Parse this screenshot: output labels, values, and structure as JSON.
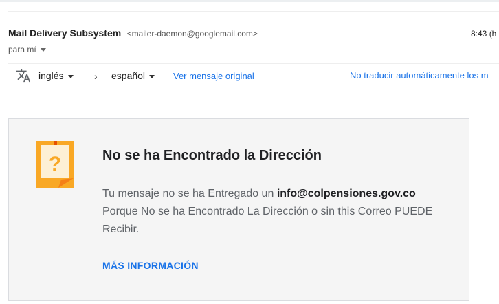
{
  "email": {
    "sender_name": "Mail Delivery Subsystem",
    "sender_email": "<mailer-daemon@googlemail.com>",
    "time": "8:43 (h",
    "recipient": "para mí"
  },
  "translate_bar": {
    "icon": "translate-icon",
    "from_language": "inglés",
    "arrow": "›",
    "to_language": "español",
    "view_original": "Ver mensaje original",
    "no_translate": "No traducir automáticamente los m"
  },
  "bounce_card": {
    "icon": "question-note-icon",
    "title": "No se ha Encontrado la Dirección",
    "body_prefix": "Tu mensaje no se ha Entregado un",
    "body_email": "info@colpensiones.gov.co",
    "body_suffix": "Porque No se ha Encontrado La Dirección o sin this Correo PUEDE Recibir.",
    "more_info": "MÁS INFORMACIÓN"
  },
  "colors": {
    "accent_link": "#1a73e8",
    "icon_orange": "#f9a825",
    "card_bg": "#f5f5f5"
  }
}
